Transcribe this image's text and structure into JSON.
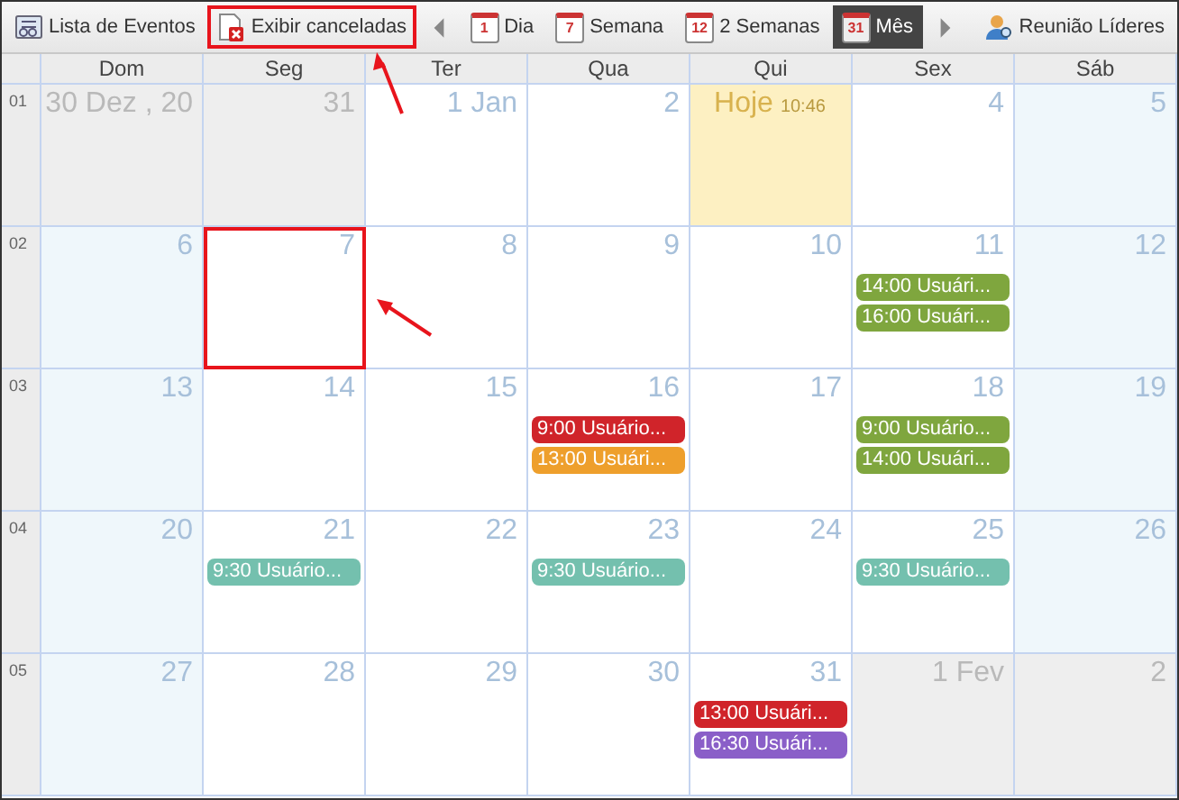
{
  "toolbar": [
    {
      "kind": "list-button",
      "label": "Lista de Eventos",
      "highlighted": false
    },
    {
      "kind": "cancel-button",
      "label": "Exibir canceladas",
      "highlighted": true
    },
    {
      "kind": "prev"
    },
    {
      "kind": "view",
      "label": "Dia",
      "icon_number": "1",
      "selected": false
    },
    {
      "kind": "view",
      "label": "Semana",
      "icon_number": "7",
      "selected": false
    },
    {
      "kind": "view",
      "label": "2 Semanas",
      "icon_number": "12",
      "selected": false
    },
    {
      "kind": "view",
      "label": "Mês",
      "icon_number": "31",
      "selected": true
    },
    {
      "kind": "next"
    },
    {
      "kind": "person-button",
      "label": "Reunião Líderes",
      "highlighted": false
    }
  ],
  "weekdays": [
    "Dom",
    "Seg",
    "Ter",
    "Qua",
    "Qui",
    "Sex",
    "Sáb"
  ],
  "weeks": [
    {
      "number": "01",
      "days": [
        {
          "label": "30 Dez , 20",
          "kind": "other",
          "highlighted": false
        },
        {
          "label": "31",
          "kind": "other",
          "highlighted": false
        },
        {
          "label": "1 Jan",
          "kind": "normal",
          "highlighted": false
        },
        {
          "label": "2",
          "kind": "normal",
          "highlighted": false
        },
        {
          "label": "Hoje",
          "time": "10:46",
          "kind": "today",
          "highlighted": false
        },
        {
          "label": "4",
          "kind": "normal",
          "highlighted": false
        },
        {
          "label": "5",
          "kind": "weekend",
          "highlighted": false
        }
      ]
    },
    {
      "number": "02",
      "days": [
        {
          "label": "6",
          "kind": "weekend",
          "highlighted": false
        },
        {
          "label": "7",
          "kind": "normal",
          "highlighted": true
        },
        {
          "label": "8",
          "kind": "normal",
          "highlighted": false
        },
        {
          "label": "9",
          "kind": "normal",
          "highlighted": false
        },
        {
          "label": "10",
          "kind": "normal",
          "highlighted": false
        },
        {
          "label": "11",
          "kind": "normal",
          "highlighted": false,
          "events": [
            {
              "text": "14:00 Usuári...",
              "color": "#7fa63e"
            },
            {
              "text": "16:00 Usuári...",
              "color": "#7fa63e"
            }
          ]
        },
        {
          "label": "12",
          "kind": "weekend",
          "highlighted": false
        }
      ]
    },
    {
      "number": "03",
      "days": [
        {
          "label": "13",
          "kind": "weekend",
          "highlighted": false
        },
        {
          "label": "14",
          "kind": "normal",
          "highlighted": false
        },
        {
          "label": "15",
          "kind": "normal",
          "highlighted": false
        },
        {
          "label": "16",
          "kind": "normal",
          "highlighted": false,
          "events": [
            {
              "text": "9:00 Usuário...",
              "color": "#d0242a"
            },
            {
              "text": "13:00 Usuári...",
              "color": "#ee9f2c"
            }
          ]
        },
        {
          "label": "17",
          "kind": "normal",
          "highlighted": false
        },
        {
          "label": "18",
          "kind": "normal",
          "highlighted": false,
          "events": [
            {
              "text": "9:00 Usuário...",
              "color": "#7fa63e"
            },
            {
              "text": "14:00 Usuári...",
              "color": "#7fa63e"
            }
          ]
        },
        {
          "label": "19",
          "kind": "weekend",
          "highlighted": false
        }
      ]
    },
    {
      "number": "04",
      "days": [
        {
          "label": "20",
          "kind": "weekend",
          "highlighted": false
        },
        {
          "label": "21",
          "kind": "normal",
          "highlighted": false,
          "events": [
            {
              "text": "9:30 Usuário...",
              "color": "#74c0ae"
            }
          ]
        },
        {
          "label": "22",
          "kind": "normal",
          "highlighted": false
        },
        {
          "label": "23",
          "kind": "normal",
          "highlighted": false,
          "events": [
            {
              "text": "9:30 Usuário...",
              "color": "#74c0ae"
            }
          ]
        },
        {
          "label": "24",
          "kind": "normal",
          "highlighted": false
        },
        {
          "label": "25",
          "kind": "normal",
          "highlighted": false,
          "events": [
            {
              "text": "9:30 Usuário...",
              "color": "#74c0ae"
            }
          ]
        },
        {
          "label": "26",
          "kind": "weekend",
          "highlighted": false
        }
      ]
    },
    {
      "number": "05",
      "days": [
        {
          "label": "27",
          "kind": "weekend",
          "highlighted": false
        },
        {
          "label": "28",
          "kind": "normal",
          "highlighted": false
        },
        {
          "label": "29",
          "kind": "normal",
          "highlighted": false
        },
        {
          "label": "30",
          "kind": "normal",
          "highlighted": false
        },
        {
          "label": "31",
          "kind": "normal",
          "highlighted": false,
          "events": [
            {
              "text": "13:00 Usuári...",
              "color": "#d0242a"
            },
            {
              "text": "16:30 Usuári...",
              "color": "#8a5fc8"
            }
          ]
        },
        {
          "label": "1 Fev",
          "kind": "other",
          "highlighted": false
        },
        {
          "label": "2",
          "kind": "other",
          "highlighted": false
        }
      ]
    }
  ]
}
